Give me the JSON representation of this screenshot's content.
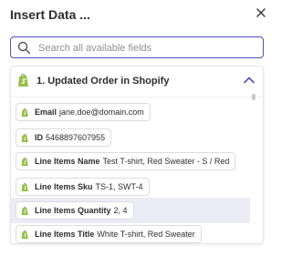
{
  "header": {
    "title": "Insert Data ..."
  },
  "search": {
    "placeholder": "Search all available fields",
    "value": ""
  },
  "group": {
    "title": "1. Updated Order in Shopify",
    "expanded": true
  },
  "fields": [
    {
      "label": "Email",
      "value": "jane.doe@domain.com"
    },
    {
      "label": "ID",
      "value": "5468897607955"
    },
    {
      "label": "Line Items Name",
      "value": "Test T-shirt, Red Sweater - S / Red"
    },
    {
      "label": "Line Items Sku",
      "value": "TS-1, SWT-4"
    },
    {
      "label": "Line Items Quantity",
      "value": "2, 4"
    },
    {
      "label": "Line Items Title",
      "value": "White T-shirt, Red Sweater"
    }
  ],
  "colors": {
    "accent": "#4d52b8",
    "shopify_green": "#95bf47",
    "highlight_row": "#ececf7"
  },
  "icons": {
    "close": "close-icon",
    "search": "search-icon",
    "group": "shopify-logo-icon",
    "collapse": "chevron-up-icon"
  }
}
